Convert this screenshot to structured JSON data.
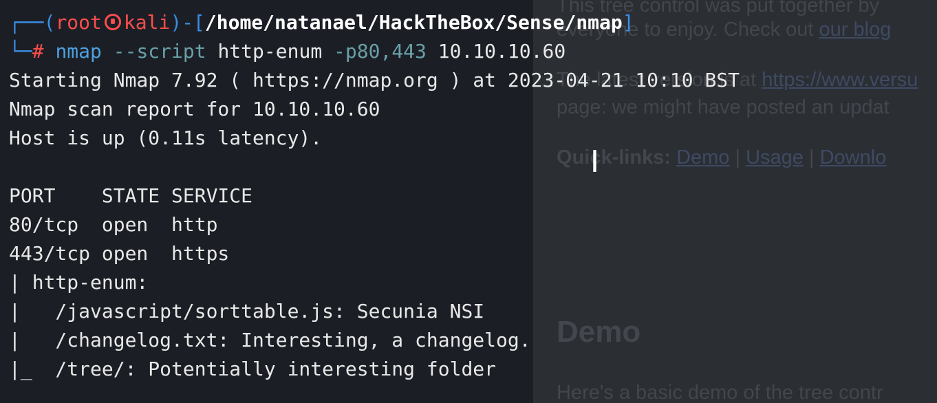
{
  "background_page": {
    "line1": "This tree control was put together by",
    "line2_pre": "everyone to enjoy. Check out ",
    "line2_link": "our blog",
    "line3_pre": "The latest version is at ",
    "line3_link": "https://www.versu",
    "line4": "page: we might have posted an updat",
    "quick_links_label": "Quick-links:",
    "quick_links": [
      "Demo",
      "Usage",
      "Downlo"
    ],
    "separator": "|",
    "demo_heading": "Demo",
    "demo_text": "Here's a basic demo of the tree contr"
  },
  "terminal": {
    "prompt": {
      "open": "┌──(",
      "user": "root",
      "host": "kali",
      "mid": ")-[",
      "path": "/home/natanael/HackTheBox/Sense/nmap",
      "close": "]",
      "line2_prefix": "└─",
      "hash": "#",
      "command": "nmap",
      "option": "--script",
      "option_value": "http-enum",
      "ports": "-p80,443",
      "target": "10.10.10.60"
    },
    "output": [
      "Starting Nmap 7.92 ( https://nmap.org ) at 2023-04-21 10:10 BST",
      "Nmap scan report for 10.10.10.60",
      "Host is up (0.11s latency).",
      "",
      "PORT    STATE SERVICE",
      "80/tcp  open  http",
      "443/tcp open  https",
      "| http-enum:",
      "|   /javascript/sorttable.js: Secunia NSI",
      "|   /changelog.txt: Interesting, a changelog.",
      "|_  /tree/: Potentially interesting folder"
    ]
  },
  "cursor_glyph": "I",
  "colors": {
    "prompt_frame": "#3a8ee6",
    "prompt_user": "#ff4d4d",
    "text": "#e8e8e8",
    "background": "#1b1f25"
  }
}
